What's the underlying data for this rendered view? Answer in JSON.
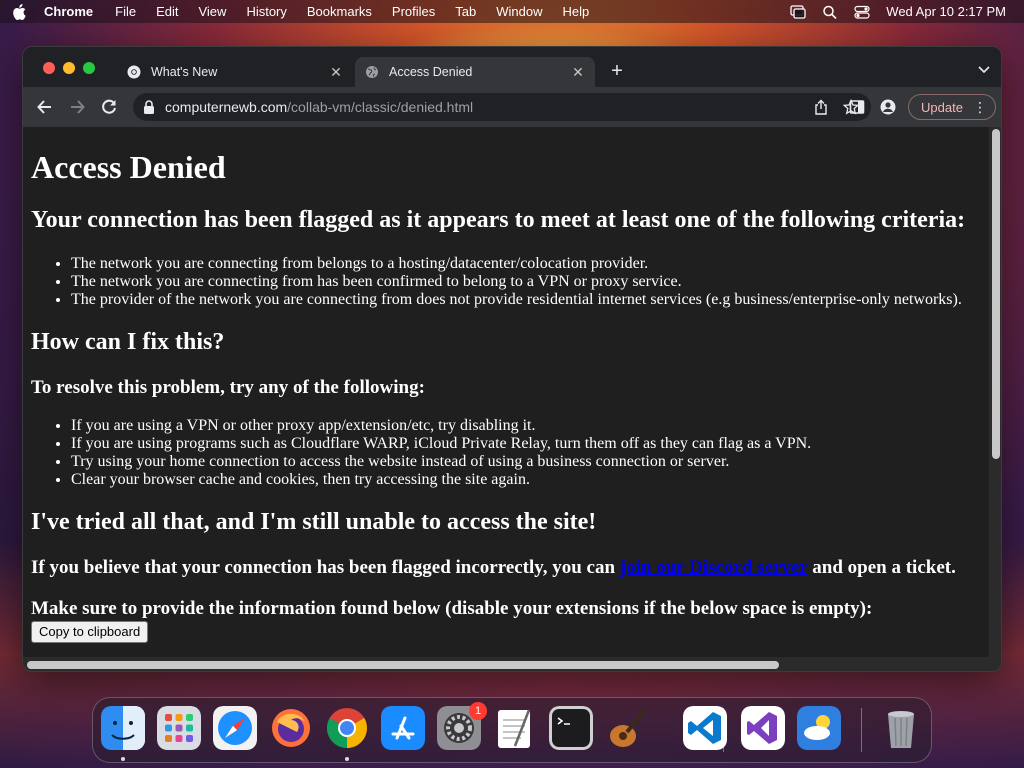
{
  "menubar": {
    "app_name": "Chrome",
    "items": [
      "File",
      "Edit",
      "View",
      "History",
      "Bookmarks",
      "Profiles",
      "Tab",
      "Window",
      "Help"
    ],
    "clock": "Wed Apr 10  2:17 PM"
  },
  "browser": {
    "tabs": [
      {
        "label": "What's New",
        "active": false
      },
      {
        "label": "Access Denied",
        "active": true
      }
    ],
    "url_host": "computernewb.com",
    "url_path": "/collab-vm/classic/denied.html",
    "update_label": "Update"
  },
  "page": {
    "title": "Access Denied",
    "flagged_heading": "Your connection has been flagged as it appears to meet at least one of the following criteria:",
    "criteria": [
      "The network you are connecting from belongs to a hosting/datacenter/colocation provider.",
      "The network you are connecting from has been confirmed to belong to a VPN or proxy service.",
      "The provider of the network you are connecting from does not provide residential internet services (e.g business/enterprise-only networks)."
    ],
    "fix_heading": "How can I fix this?",
    "resolve_subheading": "To resolve this problem, try any of the following:",
    "fixes": [
      "If you are using a VPN or other proxy app/extension/etc, try disabling it.",
      "If you are using programs such as Cloudflare WARP, iCloud Private Relay, turn them off as they can flag as a VPN.",
      "Try using your home connection to access the website instead of using a business connection or server.",
      "Clear your browser cache and cookies, then try accessing the site again."
    ],
    "still_unable_heading": "I've tried all that, and I'm still unable to access the site!",
    "incorrect_prefix": "If you believe that your connection has been flagged incorrectly, you can ",
    "discord_link": "join our Discord server",
    "incorrect_suffix": " and open a ticket.",
    "provide_info": "Make sure to provide the information found below (disable your extensions if the below space is empty):",
    "copy_button": "Copy to clipboard"
  },
  "dock": {
    "apps": [
      "Finder",
      "Launchpad",
      "Safari",
      "Firefox",
      "Google Chrome",
      "App Store",
      "System Preferences",
      "TextEdit",
      "Terminal",
      "GarageBand",
      "Visual Studio Code",
      "Visual Studio",
      "Weather",
      "Trash"
    ],
    "system_prefs_badge": "1"
  }
}
